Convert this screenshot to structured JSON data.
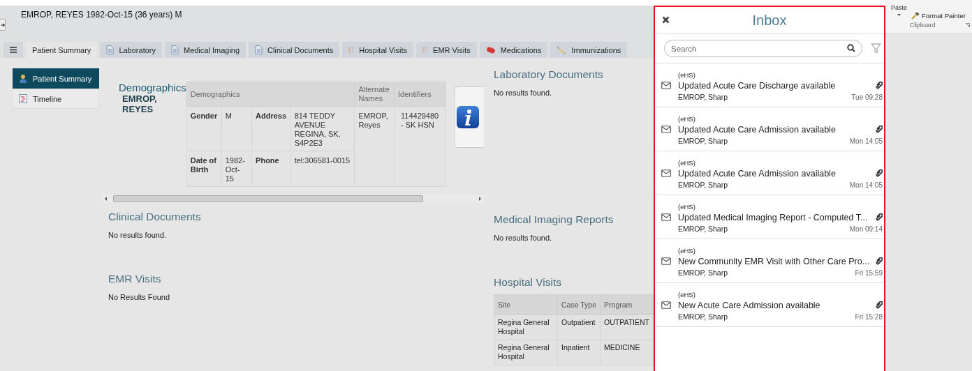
{
  "patient_header": {
    "title": "EMROP, REYES 1982-Oct-15 (36 years) M"
  },
  "tabs": [
    {
      "label": "Patient Summary",
      "kind": "summary",
      "selected": true
    },
    {
      "label": "Laboratory",
      "kind": "document",
      "selected": false
    },
    {
      "label": "Medical Imaging",
      "kind": "document",
      "selected": false
    },
    {
      "label": "Clinical Documents",
      "kind": "document",
      "selected": false
    },
    {
      "label": "Hospital Visits",
      "kind": "visit",
      "selected": false
    },
    {
      "label": "EMR Visits",
      "kind": "visit",
      "selected": false
    },
    {
      "label": "Medications",
      "kind": "medication",
      "selected": false
    },
    {
      "label": "Immunizations",
      "kind": "immunization",
      "selected": false
    }
  ],
  "sidebar": {
    "items": [
      {
        "label": "Patient Summary",
        "kind": "person",
        "selected": true
      },
      {
        "label": "Timeline",
        "kind": "timeline",
        "selected": false
      }
    ]
  },
  "demographics": {
    "heading": "Demographics",
    "name": "EMROP, REYES",
    "columns": [
      {
        "label": "Demographics",
        "colspan": 4
      },
      {
        "label": "Alternate Names"
      },
      {
        "label": "Identifiers"
      }
    ],
    "rows": [
      [
        {
          "label": "Gender",
          "value": "M"
        },
        {
          "label": "Address",
          "value": "814 TEDDY AVENUE REGINA,  SK, S4P2E3"
        }
      ],
      [
        {
          "label": "Date of Birth",
          "value": "1982-Oct-15"
        },
        {
          "label": "Phone",
          "value": "tel:306581-0015"
        }
      ]
    ],
    "alternate_names": "EMROP, Reyes",
    "identifiers": "114429480 - SK HSN"
  },
  "left_sections": [
    {
      "title": "Clinical Documents",
      "message": "No results found."
    },
    {
      "title": "EMR Visits",
      "message": "No Results Found"
    }
  ],
  "right_sections": [
    {
      "title": "Laboratory Documents",
      "message": "No results found."
    },
    {
      "title": "Medical Imaging Reports",
      "message": "No results found."
    },
    {
      "title": "Hospital Visits",
      "table": {
        "columns": [
          "Site",
          "Case Type",
          "Program"
        ],
        "rows": [
          [
            "Regina General Hospital",
            "Outpatient",
            "OUTPATIENT"
          ],
          [
            "Regina General Hospital",
            "Inpatient",
            "MEDICINE"
          ]
        ]
      }
    }
  ],
  "inbox": {
    "title": "Inbox",
    "search": {
      "placeholder": "Search"
    },
    "items": [
      {
        "source": "(eHS)",
        "subject": "Updated Acute Care Discharge available",
        "sender": "EMROP, Sharp",
        "time": "Tue 09:28",
        "attachment": true
      },
      {
        "source": "(eHS)",
        "subject": "Updated Acute Care Admission available",
        "sender": "EMROP, Sharp",
        "time": "Mon 14:05",
        "attachment": true
      },
      {
        "source": "(eHS)",
        "subject": "Updated Acute Care Admission available",
        "sender": "EMROP, Sharp",
        "time": "Mon 14:05",
        "attachment": true
      },
      {
        "source": "(eHS)",
        "subject": "Updated Medical Imaging Report - Computed T...",
        "sender": "EMROP, Sharp",
        "time": "Mon 09:14",
        "attachment": true
      },
      {
        "source": "(eHS)",
        "subject": "New Community EMR Visit with Other Care Pro...",
        "sender": "EMROP, Sharp",
        "time": "Fri 15:59",
        "attachment": true
      },
      {
        "source": "(eHS)",
        "subject": "New Acute Care Admission available",
        "sender": "EMROP, Sharp",
        "time": "Fri 15:28",
        "attachment": true
      }
    ]
  },
  "ribbon": {
    "paste": "Paste",
    "format_painter": "Format Painter",
    "group": "Clipboard"
  }
}
